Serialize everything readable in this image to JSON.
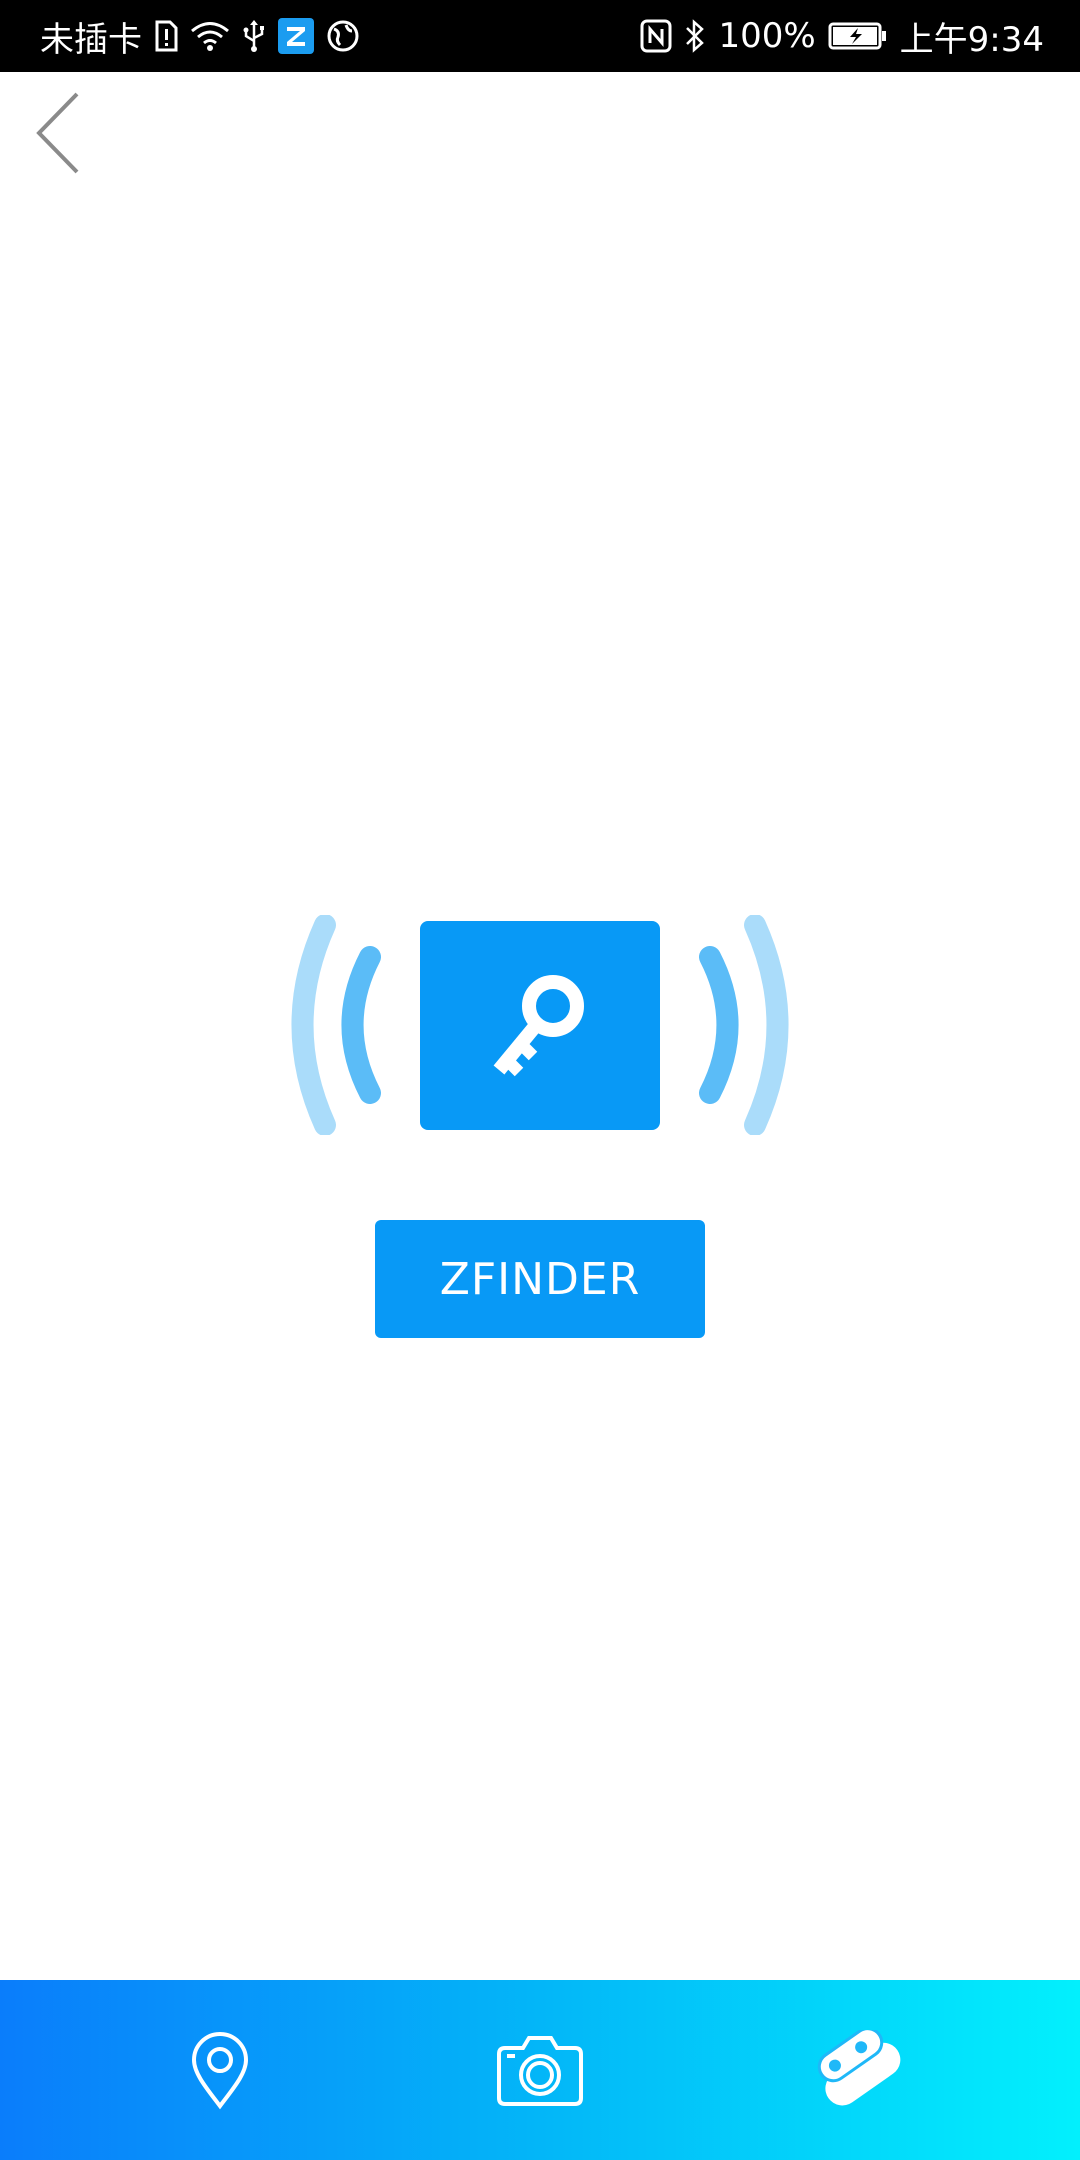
{
  "status_bar": {
    "carrier": "未插卡",
    "battery_percent": "100%",
    "time": "上午9:34",
    "icons": [
      "sim-alert-icon",
      "wifi-icon",
      "usb-icon",
      "z-app-icon",
      "vpn-globe-icon",
      "nfc-icon",
      "bluetooth-icon",
      "battery-charging-icon"
    ]
  },
  "header": {
    "back_icon": "chevron-left-icon"
  },
  "device": {
    "icon": "key-icon",
    "name_button_label": "ZFINDER"
  },
  "bottom_nav": {
    "items": [
      {
        "icon": "location-pin-icon"
      },
      {
        "icon": "camera-icon"
      },
      {
        "icon": "tag-finder-icon"
      }
    ]
  },
  "colors": {
    "accent": "#0899f6",
    "wave_inner": "#5bbcf7",
    "wave_outer": "#aadcfa",
    "nav_gradient_start": "#0a7dfb",
    "nav_gradient_end": "#02f0fd",
    "status_bar_bg": "#000000"
  }
}
